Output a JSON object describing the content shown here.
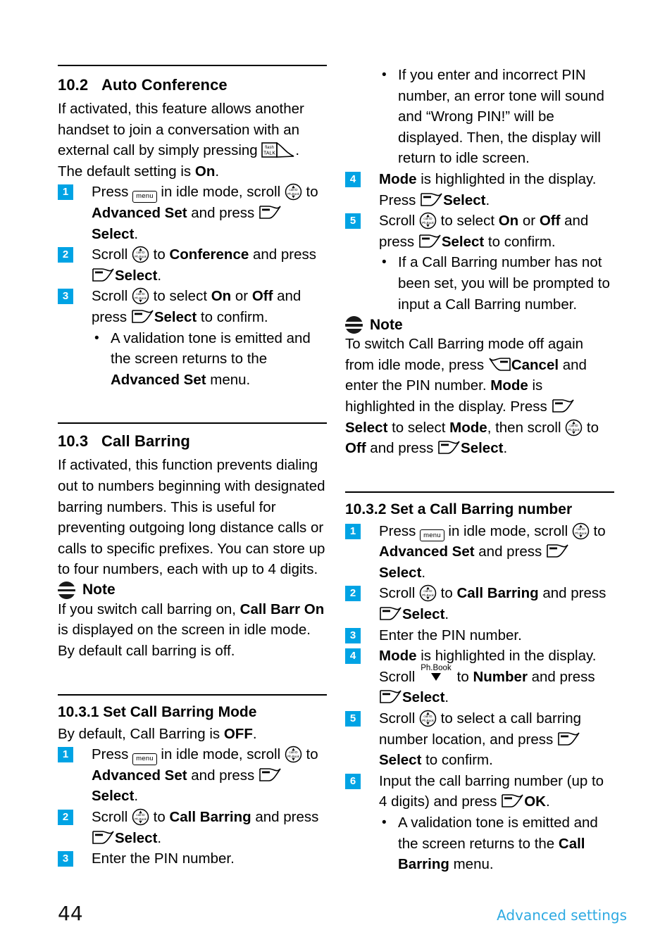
{
  "page": {
    "number": "44",
    "footer_label": "Advanced settings",
    "accent_blue": "#00a3e4",
    "footer_blue": "#2eaae2"
  },
  "icons": {
    "menu_key": "menu",
    "talk_key_top": "flash",
    "talk_key_bottom": "TALK",
    "scroll_key_top": "call ID",
    "scroll_key_bottom": "Ph.Book",
    "phbook_key": "Ph.Book",
    "note_icon": "note-icon",
    "soft_key_select": "soft-key-left-icon",
    "soft_key_cancel": "soft-key-right-icon"
  },
  "left_column": {
    "section_10_2": {
      "number": "10.2",
      "title": "Auto Conference",
      "intro_a": "If activated, this feature allows another handset to join a conversation with an external call by simply pressing ",
      "intro_b": ". The default setting is ",
      "intro_bold": "On",
      "intro_c": ".",
      "steps": [
        {
          "n": "1",
          "parts": [
            "Press ",
            " in idle mode, scroll ",
            " to ",
            "Advanced Set",
            " and press ",
            " ",
            "Select",
            "."
          ]
        },
        {
          "n": "2",
          "parts": [
            "Scroll ",
            " to ",
            "Conference",
            " and press ",
            " ",
            "Select",
            "."
          ]
        },
        {
          "n": "3",
          "parts": [
            "Scroll ",
            " to select ",
            "On",
            " or ",
            "Off",
            " and press ",
            " ",
            "Select",
            " to confirm."
          ]
        }
      ],
      "bullet_1_a": "A validation tone is emitted and the screen returns to the ",
      "bullet_1_bold": "Advanced Set",
      "bullet_1_b": " menu."
    },
    "section_10_3": {
      "number": "10.3",
      "title": "Call Barring",
      "intro": "If activated, this function prevents dialing out to numbers beginning with designated barring numbers. This is useful for preventing outgoing long distance calls or calls to specific prefixes. You can store up to four numbers, each with up to 4 digits.",
      "note_label": "Note",
      "note_a": "If you switch call barring on, ",
      "note_bold1": "Call Barr On",
      "note_b": " is displayed on the screen in idle mode. By default call barring is off."
    },
    "section_10_3_1": {
      "title": "10.3.1 Set Call Barring Mode",
      "intro_a": "By default, Call Barring is ",
      "intro_bold": "OFF",
      "intro_b": ".",
      "steps": [
        {
          "n": "1",
          "parts": [
            "Press ",
            " in idle mode, scroll ",
            " to ",
            "Advanced Set",
            " and press ",
            " ",
            "Select",
            "."
          ]
        },
        {
          "n": "2",
          "parts": [
            "Scroll ",
            " to ",
            "Call Barring",
            " and press ",
            " ",
            "Select",
            "."
          ]
        },
        {
          "n": "3",
          "parts": [
            "Enter the PIN number."
          ]
        }
      ]
    }
  },
  "right_column": {
    "top_bullet": "If you enter and incorrect PIN number, an error tone will sound and “Wrong PIN!” will be displayed. Then, the display will return to idle screen.",
    "steps_top": [
      {
        "n": "4",
        "bold_lead": "Mode",
        "text_after": " is highlighted in the display. Press ",
        "select": "Select",
        "tail": "."
      },
      {
        "n": "5",
        "lead": "Scroll ",
        "mid": " to select ",
        "on": "On",
        "or": " or ",
        "off": "Off",
        "tail_a": " and press ",
        "select": "Select",
        "tail_b": " to confirm."
      }
    ],
    "bullet_after_5": "If a Call Barring number has not been set, you will be prompted to input a Call Barring number.",
    "note_label": "Note",
    "note_parts": {
      "a": "To switch Call Barring mode off again from idle mode, press ",
      "cancel": "Cancel",
      "b": " and enter the PIN number. ",
      "mode1": "Mode",
      "c": " is highlighted in the display. Press ",
      "select1": "Select",
      "d": " to select ",
      "mode2": "Mode",
      "e": ", then scroll ",
      "f": " to ",
      "off": "Off",
      "g": " and press ",
      "select2": "Select",
      "h": "."
    },
    "section_10_3_2": {
      "title": "10.3.2 Set a Call Barring number",
      "steps": [
        {
          "n": "1",
          "parts": [
            "Press ",
            " in idle mode, scroll ",
            " to ",
            "Advanced Set",
            " and press ",
            " ",
            "Select",
            "."
          ]
        },
        {
          "n": "2",
          "parts": [
            "Scroll ",
            " to ",
            "Call Barring",
            " and press ",
            " ",
            "Select",
            "."
          ]
        },
        {
          "n": "3",
          "parts": [
            "Enter the PIN number."
          ]
        },
        {
          "n": "4",
          "parts": [
            "Mode",
            " is highlighted in the display. Scroll ",
            " to ",
            "Number",
            " and press ",
            " ",
            "Select",
            "."
          ]
        },
        {
          "n": "5",
          "parts": [
            "Scroll ",
            " to select a call barring number location, and press ",
            " ",
            "Select",
            " to confirm."
          ]
        },
        {
          "n": "6",
          "parts": [
            "Input the call barring number (up to 4 digits) and press ",
            " ",
            "OK",
            "."
          ]
        }
      ],
      "bullet_a": "A validation tone is emitted and the screen returns to the ",
      "bullet_bold": "Call Barring",
      "bullet_b": " menu."
    }
  }
}
